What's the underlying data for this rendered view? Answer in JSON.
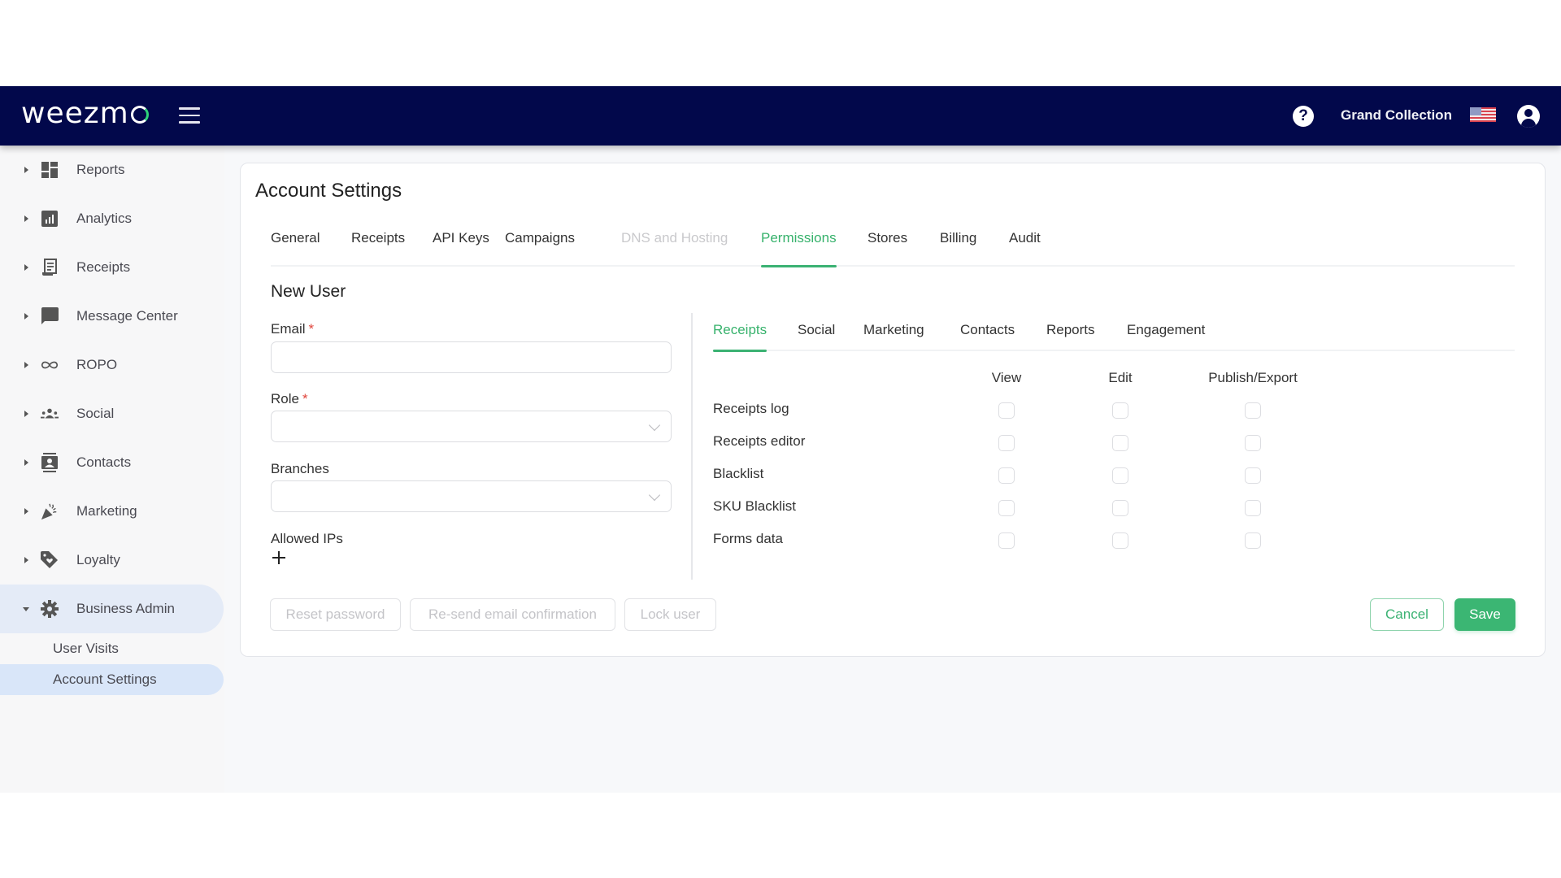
{
  "header": {
    "logo_text": "weezm",
    "account_name": "Grand Collection",
    "colors": {
      "navbar": "#02084b",
      "accent": "#3bb673"
    }
  },
  "sidebar": {
    "items": [
      {
        "label": "Reports",
        "icon": "dashboard-icon",
        "expanded": false
      },
      {
        "label": "Analytics",
        "icon": "bar-chart-icon",
        "expanded": false
      },
      {
        "label": "Receipts",
        "icon": "receipt-icon",
        "expanded": false
      },
      {
        "label": "Message Center",
        "icon": "chat-bubble-icon",
        "expanded": false
      },
      {
        "label": "ROPO",
        "icon": "infinity-icon",
        "expanded": false
      },
      {
        "label": "Social",
        "icon": "group-icon",
        "expanded": false
      },
      {
        "label": "Contacts",
        "icon": "contact-card-icon",
        "expanded": false
      },
      {
        "label": "Marketing",
        "icon": "party-popper-icon",
        "expanded": false
      },
      {
        "label": "Loyalty",
        "icon": "tag-heart-icon",
        "expanded": false
      },
      {
        "label": "Business Admin",
        "icon": "gear-icon",
        "expanded": true
      }
    ],
    "sub_items": [
      {
        "label": "User Visits",
        "active": false
      },
      {
        "label": "Account Settings",
        "active": true
      }
    ]
  },
  "page": {
    "title": "Account Settings",
    "tabs": [
      {
        "label": "General",
        "state": "normal"
      },
      {
        "label": "Receipts",
        "state": "normal"
      },
      {
        "label": "API Keys",
        "state": "normal"
      },
      {
        "label": "Campaigns",
        "state": "normal"
      },
      {
        "label": "DNS and Hosting",
        "state": "disabled"
      },
      {
        "label": "Permissions",
        "state": "active"
      },
      {
        "label": "Stores",
        "state": "normal"
      },
      {
        "label": "Billing",
        "state": "normal"
      },
      {
        "label": "Audit",
        "state": "normal"
      }
    ]
  },
  "form": {
    "section_title": "New User",
    "email": {
      "label": "Email",
      "required_mark": "*",
      "value": "",
      "placeholder": ""
    },
    "role": {
      "label": "Role",
      "required_mark": "*",
      "selected": ""
    },
    "branches": {
      "label": "Branches",
      "selected": ""
    },
    "allowed_ips": {
      "label": "Allowed IPs",
      "add_icon": "plus-icon"
    }
  },
  "permissions": {
    "tabs": [
      {
        "label": "Receipts",
        "active": true
      },
      {
        "label": "Social",
        "active": false
      },
      {
        "label": "Marketing",
        "active": false
      },
      {
        "label": "Contacts",
        "active": false
      },
      {
        "label": "Reports",
        "active": false
      },
      {
        "label": "Engagement",
        "active": false
      }
    ],
    "columns": [
      "View",
      "Edit",
      "Publish/Export"
    ],
    "rows": [
      {
        "label": "Receipts log",
        "checks": [
          false,
          false,
          false
        ]
      },
      {
        "label": "Receipts editor",
        "checks": [
          false,
          false,
          false
        ]
      },
      {
        "label": "Blacklist",
        "checks": [
          false,
          false,
          false
        ]
      },
      {
        "label": "SKU Blacklist",
        "checks": [
          false,
          false,
          false
        ]
      },
      {
        "label": "Forms data",
        "checks": [
          false,
          false,
          false
        ]
      }
    ]
  },
  "actions": {
    "reset_password": "Reset password",
    "resend_confirmation": "Re-send email confirmation",
    "lock_user": "Lock user",
    "cancel": "Cancel",
    "save": "Save"
  }
}
